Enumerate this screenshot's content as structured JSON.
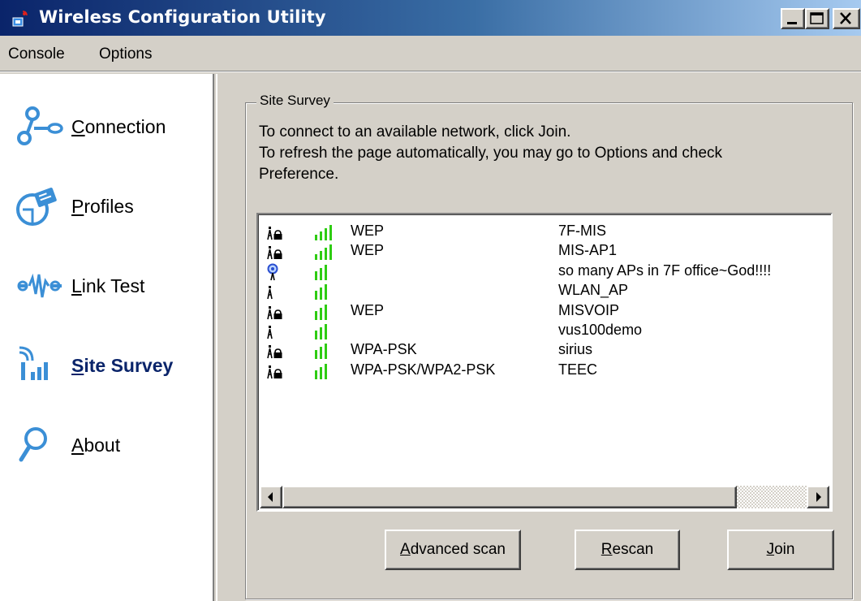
{
  "window": {
    "title": "Wireless Configuration Utility"
  },
  "menu": {
    "items": [
      "Console",
      "Options"
    ]
  },
  "sidebar": {
    "items": [
      {
        "label_first": "C",
        "label_rest": "onnection",
        "icon": "connection-icon"
      },
      {
        "label_first": "P",
        "label_rest": "rofiles",
        "icon": "profiles-icon"
      },
      {
        "label_first": "L",
        "label_rest": "ink Test",
        "icon": "link-test-icon"
      },
      {
        "label_first": "S",
        "label_rest": "ite Survey",
        "icon": "site-survey-icon",
        "active": true
      },
      {
        "label_first": "A",
        "label_rest": "bout",
        "icon": "about-icon"
      }
    ]
  },
  "site_survey": {
    "group_title": "Site Survey",
    "instructions": [
      "To connect to an available network, click Join.",
      "To refresh the page automatically, you may go to Options and check",
      "Preference."
    ],
    "networks": [
      {
        "secured": true,
        "signal_bars": 4,
        "security": "WEP",
        "ssid": "7F-MIS"
      },
      {
        "secured": true,
        "signal_bars": 4,
        "security": "WEP",
        "ssid": "MIS-AP1"
      },
      {
        "secured": false,
        "connected": true,
        "signal_bars": 3,
        "security": "",
        "ssid": "so many APs in 7F office~God!!!!"
      },
      {
        "secured": false,
        "signal_bars": 3,
        "security": "",
        "ssid": "WLAN_AP"
      },
      {
        "secured": true,
        "signal_bars": 3,
        "security": "WEP",
        "ssid": "MISVOIP"
      },
      {
        "secured": false,
        "signal_bars": 3,
        "security": "",
        "ssid": "vus100demo"
      },
      {
        "secured": true,
        "signal_bars": 3,
        "security": "WPA-PSK",
        "ssid": "sirius"
      },
      {
        "secured": true,
        "signal_bars": 3,
        "security": "WPA-PSK/WPA2-PSK",
        "ssid": "TEEC"
      }
    ],
    "buttons": {
      "advanced_first": "A",
      "advanced_rest": "dvanced scan",
      "rescan_first": "R",
      "rescan_rest": "escan",
      "join_first": "J",
      "join_rest": "oin"
    }
  },
  "colors": {
    "title_gradient_start": "#0a246a",
    "active_nav": "#0a246a",
    "signal_green": "#2ecc12",
    "icon_blue": "#3b8fd6"
  }
}
